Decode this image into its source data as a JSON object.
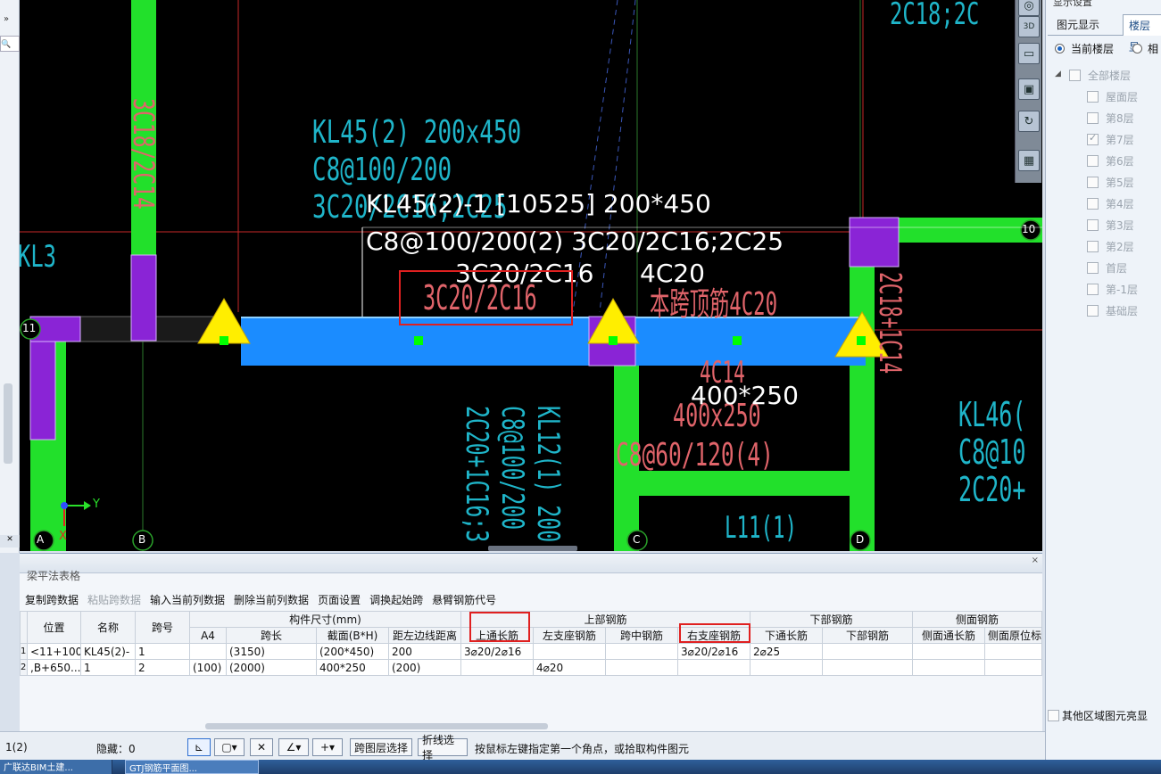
{
  "canvas": {
    "grid_labels": {
      "a": "A",
      "b": "B",
      "c": "C",
      "d": "D",
      "row11": "11",
      "row10": "10"
    },
    "axis": {
      "y": "Y",
      "x": "X"
    },
    "cad_text": {
      "kl45_l1": "KL45(2) 200x450",
      "kl45_l2": "C8@100/200",
      "kl45_l3": "3C20/2C16;2C25",
      "col_left": "3C18/2C14",
      "kl3": "KL3",
      "red_top": "3C20/2C16",
      "red_span": "本跨顶筋4C20",
      "red_mid": "4C14",
      "red_sec": "400x250",
      "red_stir": "C8@60/120(4)",
      "red_right": "2C18+1C14",
      "col_top": "2C18;2C",
      "kl12_l1": "KL12(1) 200",
      "kl12_l2": "C8@100/200",
      "kl12_l3": "2C20+1C16;3",
      "kl46_l1": "KL46(",
      "kl46_l2": "C8@10",
      "kl46_l3": "2C20+",
      "l11": "L11(1)"
    },
    "white_text": {
      "w1": "KL45(2)-1 [10525] 200*450",
      "w2": "C8@100/200(2) 3C20/2C16;2C25",
      "w3": "3C20/2C16",
      "w4": "4C20",
      "w5": "400*250"
    }
  },
  "right_panel": {
    "title": "显示设置",
    "tabs": [
      "图元显示",
      "楼层显"
    ],
    "radios": [
      "当前楼层",
      "相"
    ],
    "tree_root": "全部楼层",
    "floors": [
      {
        "label": "屋面层",
        "checked": false
      },
      {
        "label": "第8层",
        "checked": false
      },
      {
        "label": "第7层",
        "checked": true
      },
      {
        "label": "第6层",
        "checked": false
      },
      {
        "label": "第5层",
        "checked": false
      },
      {
        "label": "第4层",
        "checked": false
      },
      {
        "label": "第3层",
        "checked": false
      },
      {
        "label": "第2层",
        "checked": false
      },
      {
        "label": "首层",
        "checked": false
      },
      {
        "label": "第-1层",
        "checked": false
      },
      {
        "label": "基础层",
        "checked": false
      }
    ],
    "bottom_check": "其他区域图元亮显"
  },
  "table_panel": {
    "title": "梁平法表格",
    "toolbar": [
      "复制跨数据",
      "粘贴跨数据",
      "输入当前列数据",
      "删除当前列数据",
      "页面设置",
      "调换起始跨",
      "悬臂钢筋代号"
    ],
    "group_headers": {
      "size": "构件尺寸(mm)",
      "top": "上部钢筋",
      "bottom": "下部钢筋",
      "side": "侧面钢筋"
    },
    "columns": [
      "位置",
      "名称",
      "跨号",
      "A4",
      "跨长",
      "截面(B*H)",
      "距左边线距离",
      "上通长筋",
      "左支座钢筋",
      "跨中钢筋",
      "右支座钢筋",
      "下通长筋",
      "下部钢筋",
      "侧面通长筋",
      "侧面原位标"
    ],
    "rows": [
      {
        "idx": "1",
        "pos": "<11+100",
        "name": "KL45(2)-",
        "span": "1",
        "a4": "",
        "len": "(3150)",
        "sec": "(200*450)",
        "dist": "200",
        "top_long": "3⌀20/2⌀16",
        "left_sup": "",
        "mid": "",
        "right_sup": "3⌀20/2⌀16",
        "bot_long": "2⌀25",
        "bot": "",
        "side_long": "",
        "side_pos": ""
      },
      {
        "idx": "2",
        "pos": ",B+650...",
        "name": "1",
        "span": "2",
        "a4": "(100)",
        "len": "(2000)",
        "sec": "400*250",
        "dist": "(200)",
        "top_long": "",
        "left_sup": "4⌀20",
        "mid": "",
        "right_sup": "",
        "bot_long": "",
        "bot": "",
        "side_long": "",
        "side_pos": ""
      }
    ]
  },
  "status": {
    "left": "1(2)",
    "hidden": "隐藏：0",
    "btn_span_layer": "跨图层选择",
    "btn_polyline": "折线选择",
    "hint": "按鼠标左键指定第一个角点，或拾取构件图元"
  },
  "taskbar": {
    "item1": "广联达BIM土建...",
    "item2": "GTJ钢筋平面图..."
  }
}
